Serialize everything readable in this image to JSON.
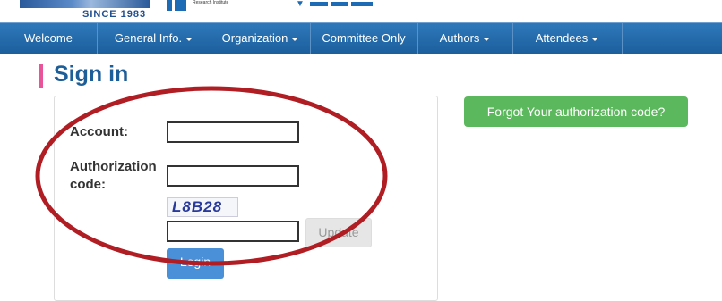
{
  "header": {
    "since_text": "SINCE 1983",
    "institute_text": "Research Institute"
  },
  "nav": {
    "items": [
      {
        "label": "Welcome",
        "dropdown": false
      },
      {
        "label": "General Info.",
        "dropdown": true
      },
      {
        "label": "Organization",
        "dropdown": true
      },
      {
        "label": "Committee Only",
        "dropdown": false
      },
      {
        "label": "Authors",
        "dropdown": true
      },
      {
        "label": "Attendees",
        "dropdown": true
      }
    ]
  },
  "page": {
    "title": "Sign in"
  },
  "form": {
    "account_label": "Account:",
    "account_value": "",
    "auth_label_line1": "Authorization",
    "auth_label_line2": "code:",
    "auth_value": "",
    "captcha_text": "L8B28",
    "captcha_value": "",
    "update_label": "Update",
    "login_label": "Login"
  },
  "forgot": {
    "label": "Forgot Your authorization code?"
  },
  "colors": {
    "nav": "#2469a9",
    "title": "#1d5e98",
    "accent": "#e8539a",
    "forgot_button": "#5cb85c",
    "login_button": "#4a90d9",
    "annotation_circle": "#b01e24"
  }
}
